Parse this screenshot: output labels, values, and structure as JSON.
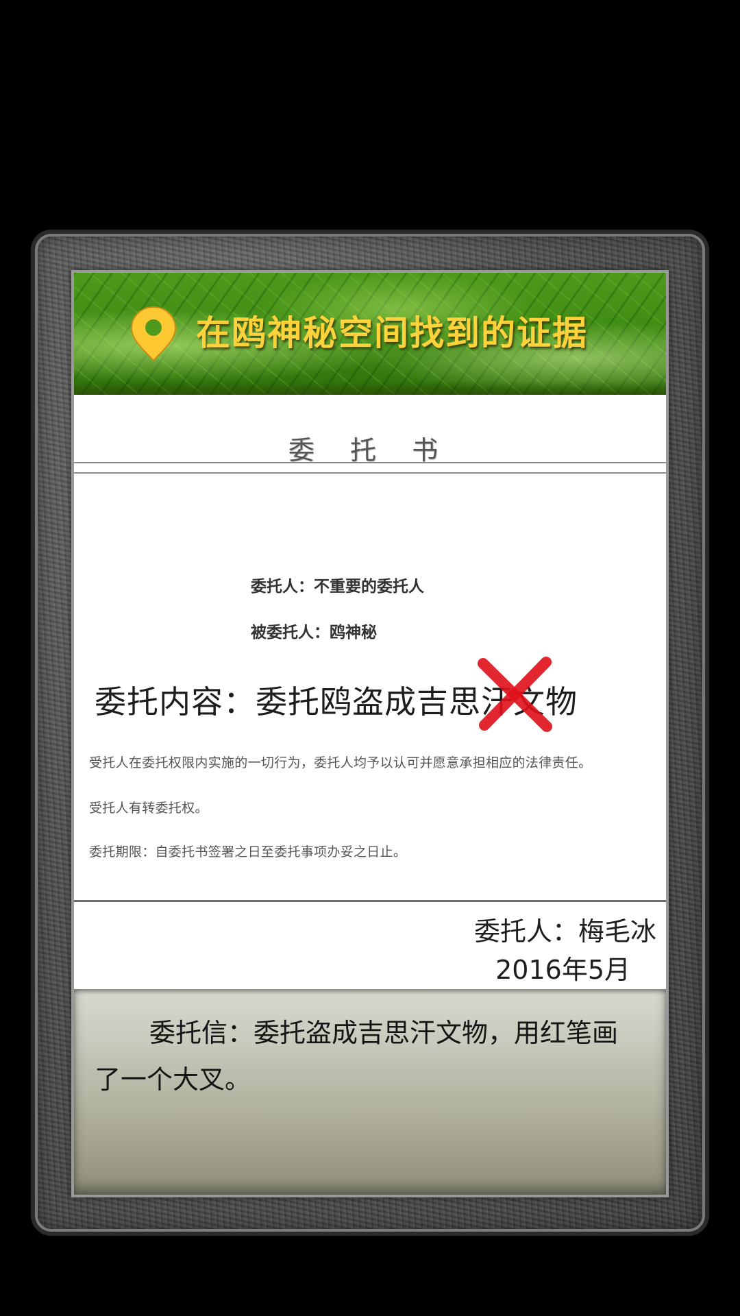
{
  "header": {
    "title": "在鸥神秘空间找到的证据",
    "icon": "map-pin-icon",
    "accent": "#ffd23c"
  },
  "document": {
    "title": "委 托 书",
    "client_line": "委托人：不重要的委托人",
    "agent_line": "被委托人：鸥神秘",
    "content_line": "委托内容：委托鸥盗成吉思汗文物",
    "cross_mark": "red-x-icon",
    "fine_print": [
      "受托人在委托权限内实施的一切行为，委托人均予以认可并愿意承担相应的法律责任。",
      "受托人有转委托权。",
      "委托期限：自委托书签署之日至委托事项办妥之日止。"
    ],
    "signer": "委托人：梅毛冰",
    "date": "2016年5月"
  },
  "description": {
    "text": "委托信：委托盗成吉思汗文物，用红笔画了一个大叉。"
  }
}
